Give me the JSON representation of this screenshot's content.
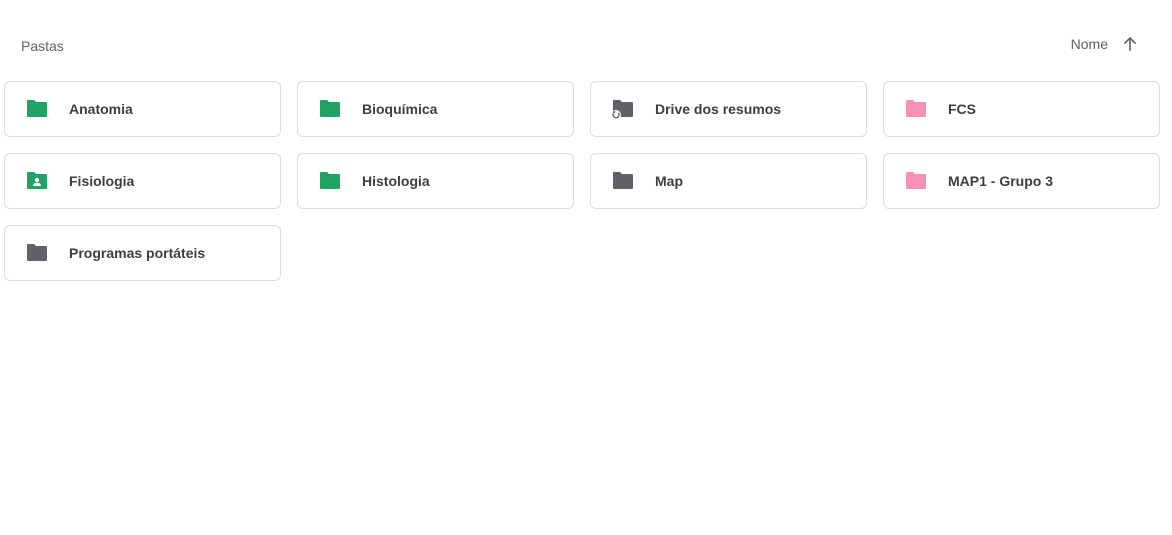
{
  "section": {
    "label": "Pastas"
  },
  "sort": {
    "label": "Nome",
    "direction_icon": "arrow-up-icon"
  },
  "colors": {
    "green": "#1fa463",
    "grey": "#5f6368",
    "pink": "#f691b2",
    "border": "#dadce0"
  },
  "folders": [
    {
      "label": "Anatomia",
      "color": "#1fa463",
      "icon": "folder-icon"
    },
    {
      "label": "Bioquímica",
      "color": "#1fa463",
      "icon": "folder-icon"
    },
    {
      "label": "Drive dos resumos",
      "color": "#5f6368",
      "icon": "folder-sync-icon"
    },
    {
      "label": "FCS",
      "color": "#f691b2",
      "icon": "folder-icon"
    },
    {
      "label": "Fisiologia",
      "color": "#1fa463",
      "icon": "shared-folder-icon"
    },
    {
      "label": "Histologia",
      "color": "#1fa463",
      "icon": "folder-icon"
    },
    {
      "label": "Map",
      "color": "#5f6368",
      "icon": "folder-icon"
    },
    {
      "label": "MAP1 - Grupo 3",
      "color": "#f691b2",
      "icon": "folder-icon"
    },
    {
      "label": "Programas portáteis",
      "color": "#5f6368",
      "icon": "folder-icon"
    }
  ]
}
